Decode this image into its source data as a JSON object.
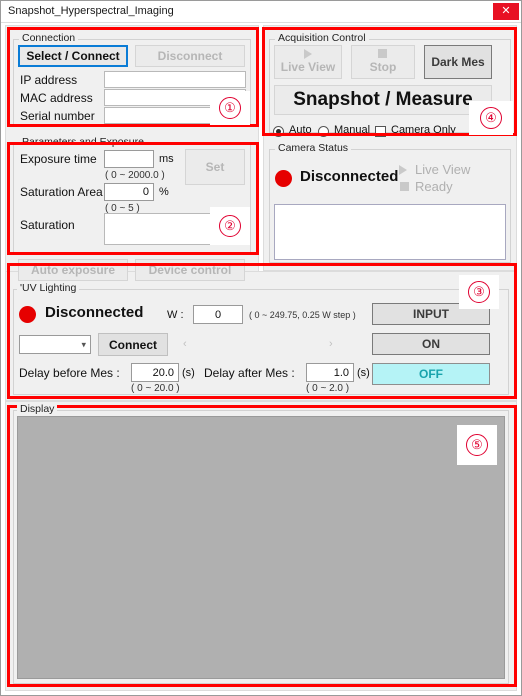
{
  "window": {
    "title": "Snapshot_Hyperspectral_Imaging",
    "close_label": "✕"
  },
  "connection": {
    "group_label": "Connection",
    "select_connect_label": "Select / Connect",
    "disconnect_label": "Disconnect",
    "ip_label": "IP address",
    "mac_label": "MAC address",
    "serial_label": "Serial number",
    "ip_value": "",
    "mac_value": "",
    "serial_value": ""
  },
  "parameters": {
    "group_label": "Parameters and Exposure",
    "exposure_label": "Exposure time",
    "exposure_value": "",
    "exposure_unit": "ms",
    "exposure_range": "( 0 ~ 2000.0 )",
    "set_label": "Set",
    "saturation_area_label": "Saturation Area",
    "saturation_area_value": "0",
    "saturation_area_unit": "%",
    "saturation_area_range": "( 0 ~ 5 )",
    "saturation_label": "Saturation",
    "saturation_value": "",
    "auto_exposure_label": "Auto exposure",
    "device_control_label": "Device control"
  },
  "uv": {
    "group_label": "'UV Lighting",
    "status_text": "Disconnected",
    "status_color": "#e60000",
    "w_label": "W :",
    "w_value": "0",
    "w_range": "( 0 ~ 249.75, 0.25 W step )",
    "port_value": "",
    "connect_label": "Connect",
    "prev_arrow": "‹",
    "next_arrow": "›",
    "delay_before_label": "Delay before Mes :",
    "delay_before_value": "20.0",
    "delay_before_unit": "(s)",
    "delay_before_range": "( 0 ~ 20.0 )",
    "delay_after_label": "Delay after Mes :",
    "delay_after_value": "1.0",
    "delay_after_unit": "(s)",
    "delay_after_range": "( 0 ~ 2.0 )",
    "input_label": "INPUT",
    "on_label": "ON",
    "off_label": "OFF",
    "off_color": "#b5f3f6"
  },
  "acquisition": {
    "group_label": "Acquisition Control",
    "live_view_label": "Live View",
    "stop_label": "Stop",
    "dark_mes_label": "Dark Mes",
    "snapshot_label": "Snapshot / Measure",
    "auto_label": "Auto",
    "manual_label": "Manual",
    "camera_only_label": "Camera Only",
    "mode_selected": "Auto",
    "camera_only_checked": false
  },
  "camera_status": {
    "group_label": "Camera Status",
    "status_text": "Disconnected",
    "status_color": "#e60000",
    "live_view_label": "Live View",
    "ready_label": "Ready",
    "log_value": ""
  },
  "display": {
    "group_label": "Display"
  },
  "annotations": {
    "accent_color": "#ff0000",
    "marker_color": "#e00030",
    "markers": [
      {
        "id": "1",
        "label": "①"
      },
      {
        "id": "2",
        "label": "②"
      },
      {
        "id": "3",
        "label": "③"
      },
      {
        "id": "4",
        "label": "④"
      },
      {
        "id": "5",
        "label": "⑤"
      }
    ]
  }
}
